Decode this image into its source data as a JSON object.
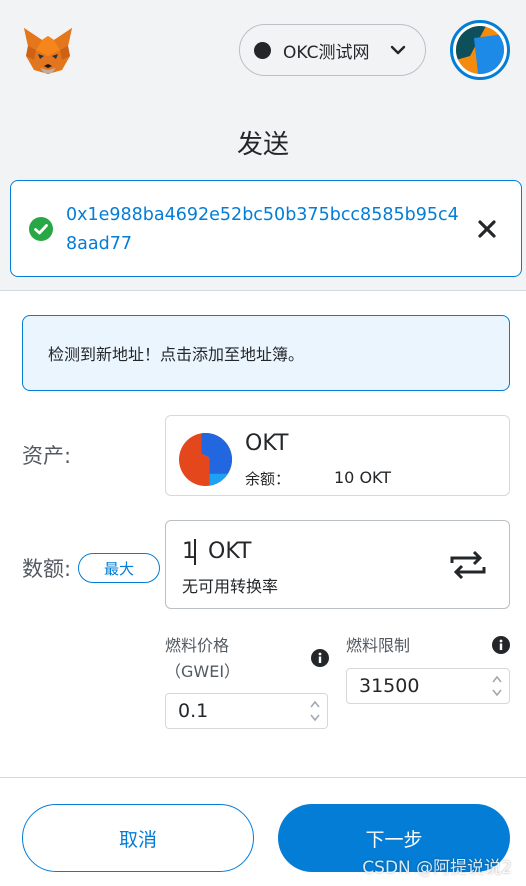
{
  "header": {
    "network_label": "OKC测试网",
    "logo_icon": "metamask-fox-icon",
    "account_icon": "account-avatar-icon"
  },
  "page_title": "发送",
  "recipient": {
    "address": "0x1e988ba4692e52bc50b375bcc8585b95c48aad77",
    "status_icon": "check-circle-icon",
    "close_icon": "close-icon"
  },
  "notice": {
    "text": "检测到新地址！点击添加至地址簿。"
  },
  "asset": {
    "label": "资产:",
    "name": "OKT",
    "balance_label": "余额：",
    "balance_value": "10 OKT"
  },
  "amount": {
    "label": "数额:",
    "max_label": "最大",
    "value": "1",
    "unit": "OKT",
    "conversion": "无可用转换率"
  },
  "gas": {
    "price_label": "燃料价格",
    "price_unit": "（GWEI）",
    "price_value": "0.1",
    "limit_label": "燃料限制",
    "limit_value": "31500"
  },
  "footer": {
    "cancel_label": "取消",
    "next_label": "下一步"
  },
  "watermark": "CSDN @阿提说说2",
  "colors": {
    "accent": "#037dd6",
    "success": "#28a745",
    "notice_bg": "#eaf5fe"
  }
}
